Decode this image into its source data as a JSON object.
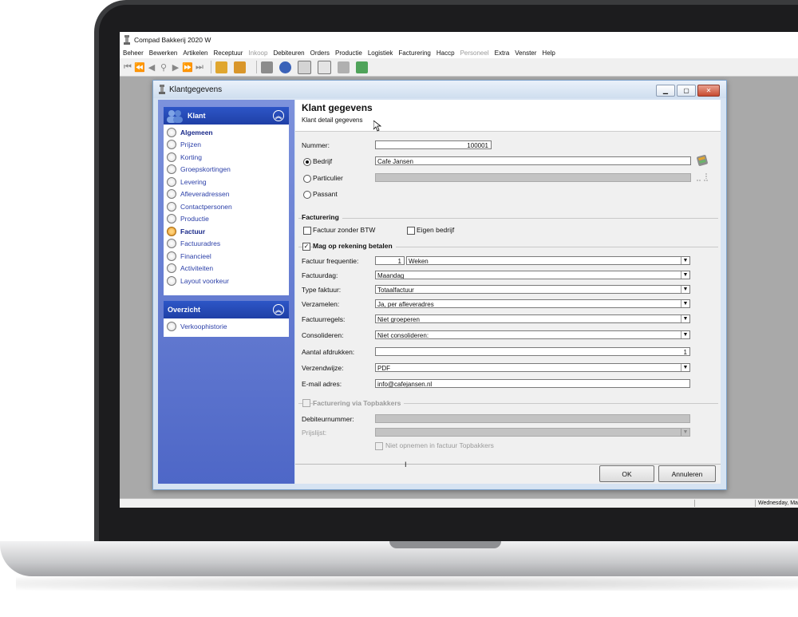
{
  "app": {
    "title": "Compad Bakkerij 2020 W",
    "menu": [
      {
        "label": "Beheer",
        "disabled": false
      },
      {
        "label": "Bewerken",
        "disabled": false
      },
      {
        "label": "Artikelen",
        "disabled": false
      },
      {
        "label": "Receptuur",
        "disabled": false
      },
      {
        "label": "Inkoop",
        "disabled": true
      },
      {
        "label": "Debiteuren",
        "disabled": false
      },
      {
        "label": "Orders",
        "disabled": false
      },
      {
        "label": "Productie",
        "disabled": false
      },
      {
        "label": "Logistiek",
        "disabled": false
      },
      {
        "label": "Facturering",
        "disabled": false
      },
      {
        "label": "Haccp",
        "disabled": false
      },
      {
        "label": "Personeel",
        "disabled": true
      },
      {
        "label": "Extra",
        "disabled": false
      },
      {
        "label": "Venster",
        "disabled": false
      },
      {
        "label": "Help",
        "disabled": false
      }
    ],
    "status_date": "Wednesday, Marc"
  },
  "dialog": {
    "title": "Klantgegevens",
    "header": {
      "title": "Klant gegevens",
      "subtitle": "Klant detail gegevens"
    },
    "sidebar": {
      "klant_panel": {
        "title": "Klant",
        "items": [
          "Algemeen",
          "Prijzen",
          "Korting",
          "Groepskortingen",
          "Levering",
          "Afleveradressen",
          "Contactpersonen",
          "Productie",
          "Factuur",
          "Factuuradres",
          "Financieel",
          "Activiteiten",
          "Layout voorkeur"
        ]
      },
      "overzicht_panel": {
        "title": "Overzicht",
        "items": [
          "Verkoophistorie"
        ]
      }
    },
    "form": {
      "nummer_label": "Nummer:",
      "nummer_value": "100001",
      "bedrijf_label": "Bedrijf",
      "bedrijf_value": "Cafe Jansen",
      "particulier_label": "Particulier",
      "passant_label": "Passant",
      "facturering_title": "Facturering",
      "zonder_btw_label": "Factuur zonder BTW",
      "eigen_bedrijf_label": "Eigen bedrijf",
      "rekening_label": "Mag op rekening betalen",
      "frequentie_label": "Factuur frequentie:",
      "frequentie_number": "1",
      "frequentie_unit": "Weken",
      "factuurdag_label": "Factuurdag:",
      "factuurdag_value": "Maandag",
      "type_label": "Type faktuur:",
      "type_value": "Totaalfactuur",
      "verzamelen_label": "Verzamelen:",
      "verzamelen_value": "Ja, per afleveradres",
      "factuurregels_label": "Factuurregels:",
      "factuurregels_value": "Niet groeperen",
      "consolideren_label": "Consolideren:",
      "consolideren_value": "Niet consolideren:",
      "afdrukken_label": "Aantal afdrukken:",
      "afdrukken_value": "1",
      "verzendwijze_label": "Verzendwijze:",
      "verzendwijze_value": "PDF",
      "email_label": "E-mail adres:",
      "email_value": "info@cafejansen.nl",
      "topbakkers_title": "Facturering via Topbakkers",
      "debiteurnummer_label": "Debiteurnummer:",
      "prijslijst_label": "Prijslijst:",
      "niet_opnemen_label": "Niet opnemen in factuur Topbakkers"
    },
    "buttons": {
      "ok": "OK",
      "cancel": "Annuleren"
    }
  },
  "colors": {
    "sidebar_top": "#7d92dc",
    "sidebar_bottom": "#4e67c7",
    "panel_header": "#2d56c7",
    "nav_text": "#2b3fa8",
    "active_radio": "#e08a18"
  }
}
